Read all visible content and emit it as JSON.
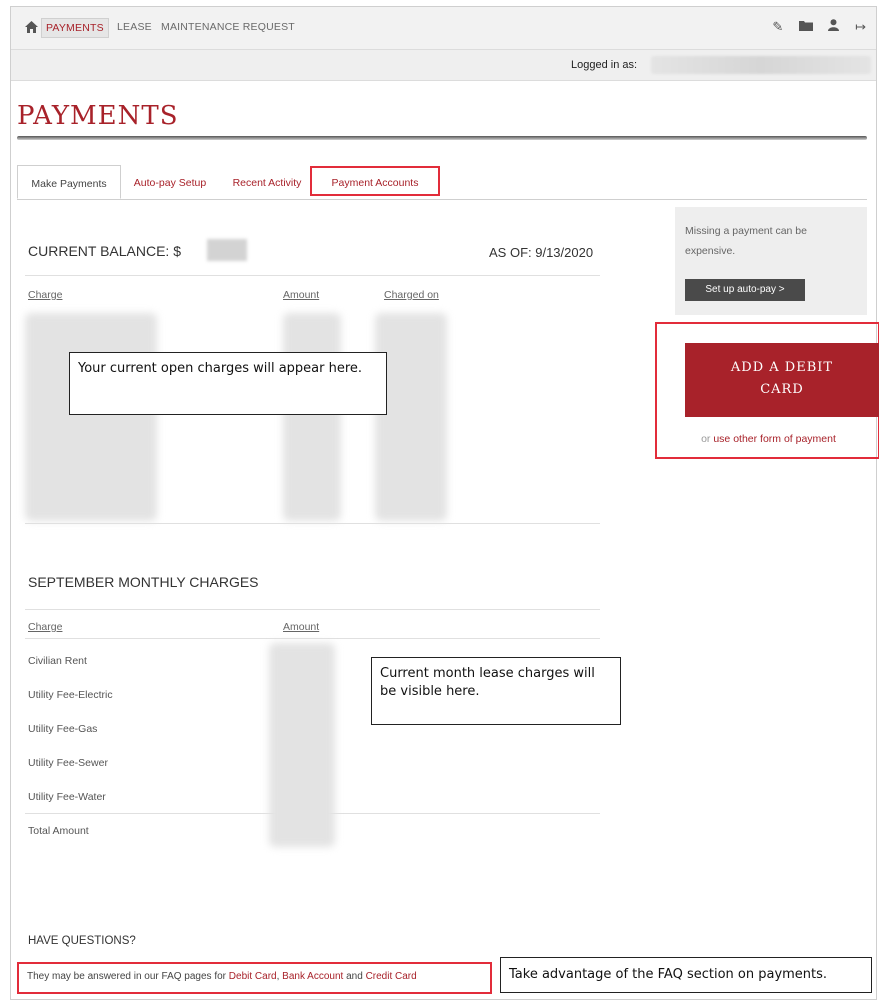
{
  "nav": {
    "home_icon": "home-icon",
    "items": [
      "PAYMENTS",
      "LEASE",
      "MAINTENANCE REQUEST"
    ],
    "right_icons": [
      "pencil-icon",
      "folder-icon",
      "user-icon",
      "sign-out-icon"
    ]
  },
  "login": {
    "label": "Logged in as:"
  },
  "page": {
    "title": "PAYMENTS"
  },
  "tabs": [
    "Make Payments",
    "Auto-pay Setup",
    "Recent Activity",
    "Payment Accounts"
  ],
  "balance": {
    "heading": "CURRENT BALANCE: $",
    "as_of": "AS OF: 9/13/2020",
    "columns": [
      "Charge",
      "Amount",
      "Charged on"
    ],
    "callout": "Your current open charges will appear here."
  },
  "monthly": {
    "heading": "SEPTEMBER MONTHLY CHARGES",
    "columns": [
      "Charge",
      "Amount"
    ],
    "rows": [
      "Civilian Rent",
      "Utility Fee-Electric",
      "Utility Fee-Gas",
      "Utility Fee-Sewer",
      "Utility Fee-Water",
      "Total Amount"
    ],
    "callout": "Current month lease charges will be visible here."
  },
  "side": {
    "text": "Missing a payment can be expensive.",
    "autopay_button": "Set up auto-pay >",
    "debit_button_line1": "ADD A DEBIT",
    "debit_button_line2": "CARD",
    "other_prefix": "or ",
    "other_link": "use other form of payment"
  },
  "faq": {
    "heading": "HAVE QUESTIONS?",
    "text": "They may be answered in our FAQ pages for ",
    "link1": "Debit Card",
    "sep1": ", ",
    "link2": "Bank Account",
    "sep2": " and ",
    "link3": "Credit Card",
    "callout": "Take advantage of the FAQ section on payments."
  },
  "colors": {
    "accent": "#a8222a",
    "highlight": "#e22c3a",
    "dark_button": "#4a4a4a"
  }
}
